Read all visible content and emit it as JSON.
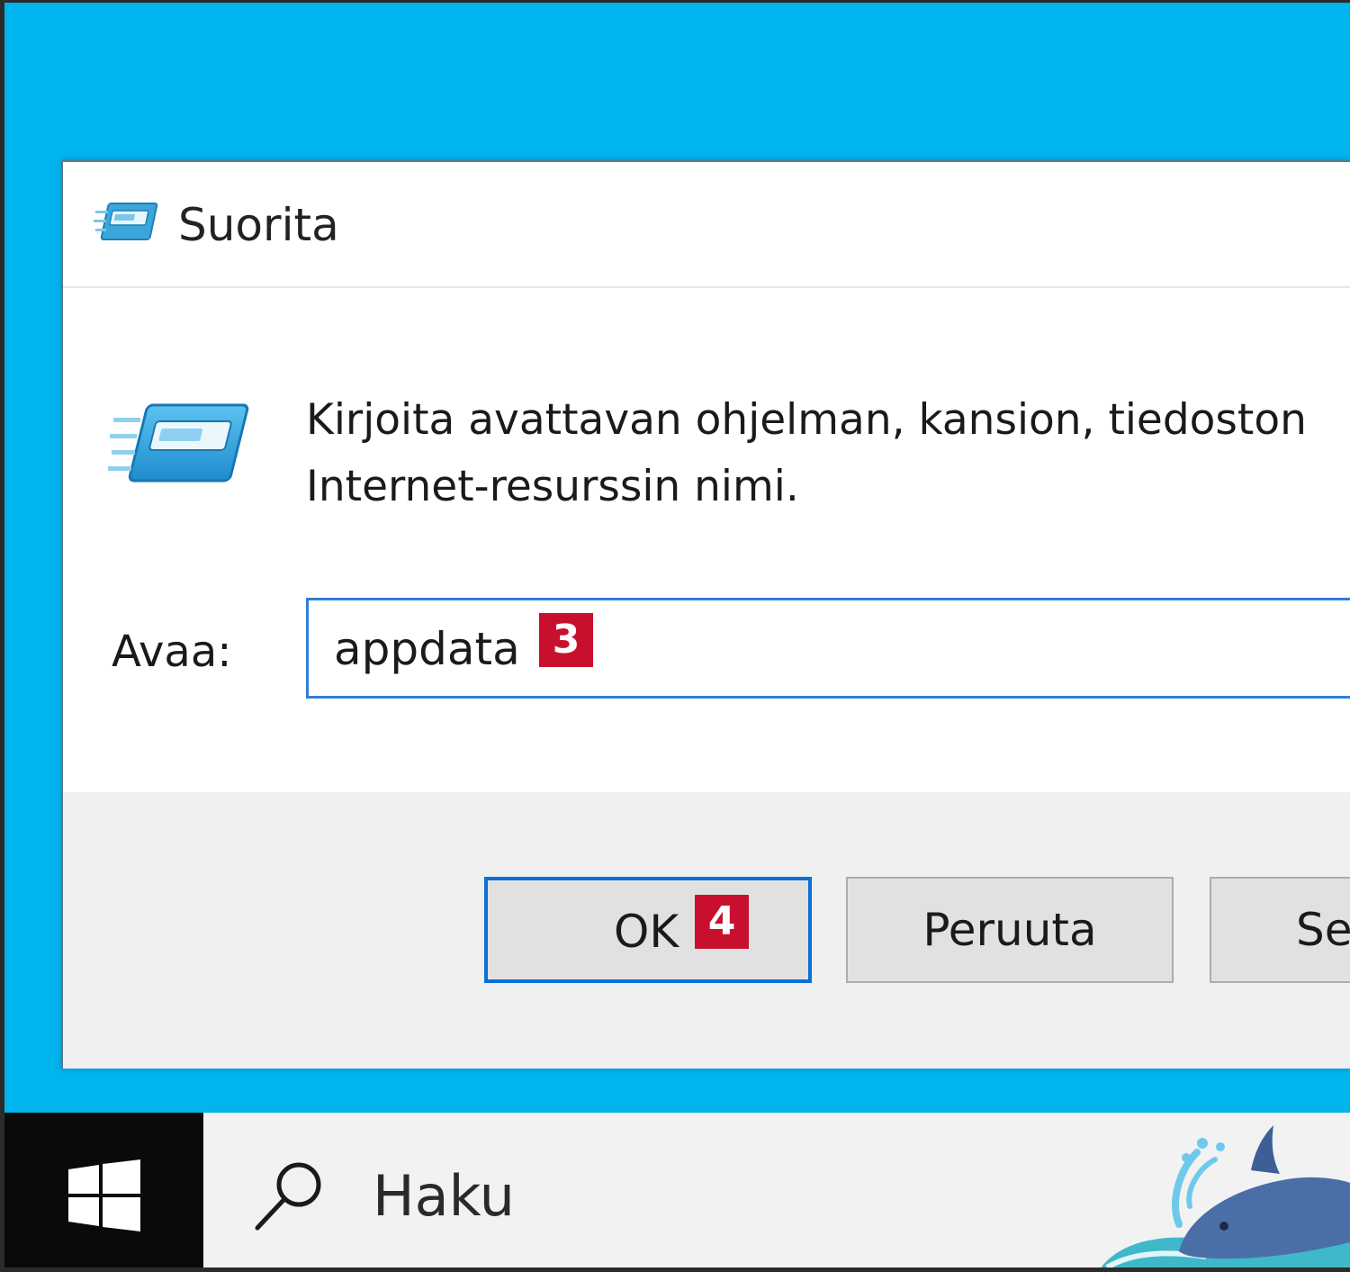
{
  "dialog": {
    "title": "Suorita",
    "description_line1": "Kirjoita avattavan ohjelman, kansion, tiedoston",
    "description_line2": "Internet-resurssin nimi.",
    "open_label": "Avaa:",
    "open_value": "appdata",
    "buttons": {
      "ok": "OK",
      "cancel": "Peruuta",
      "browse": "Se"
    }
  },
  "annotations": {
    "input_step": "3",
    "ok_step": "4"
  },
  "taskbar": {
    "search_placeholder": "Haku"
  },
  "colors": {
    "desktop": "#00b4ee",
    "accent": "#0a6fd6",
    "step_badge": "#c8102e",
    "taskbar_start": "#0a0a0a"
  },
  "icons": {
    "title": "run-dialog-icon",
    "body": "run-dialog-icon",
    "start": "windows-logo-icon",
    "search": "search-icon"
  }
}
